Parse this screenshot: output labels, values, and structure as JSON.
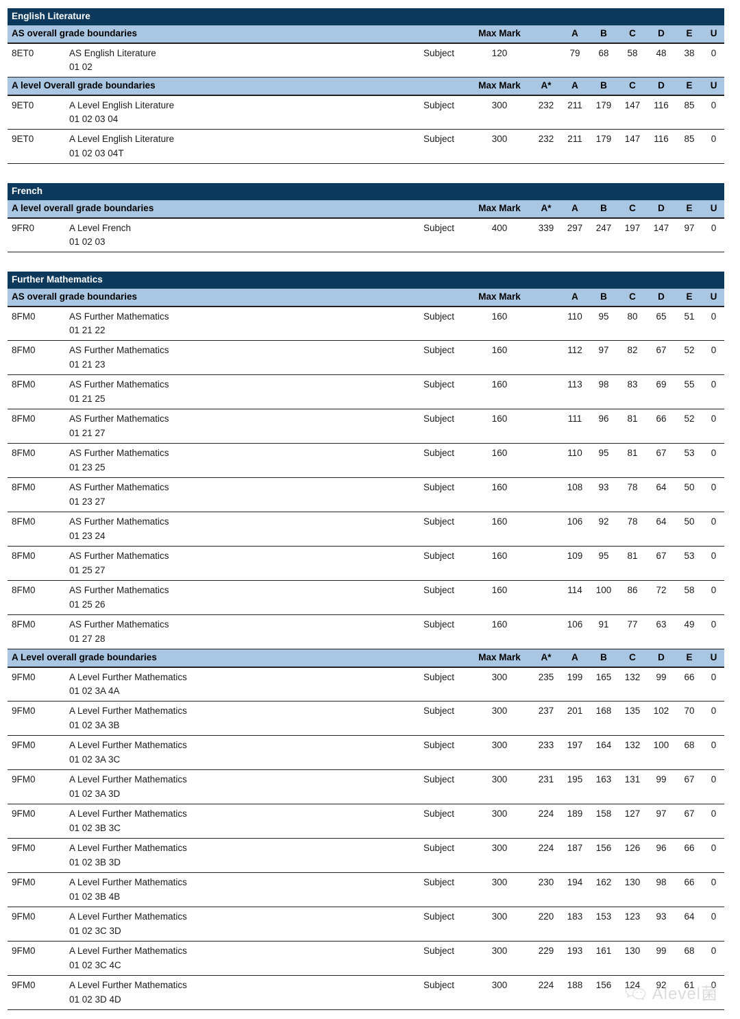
{
  "colors": {
    "subject_band": "#0d3a5c",
    "header_band": "#a9c7e2",
    "rule": "#231f20",
    "text": "#1a1a1a",
    "watermark": "#b9b9bd"
  },
  "columns": {
    "max_mark": "Max Mark",
    "a_star": "A*",
    "a": "A",
    "b": "B",
    "c": "C",
    "d": "D",
    "e": "E",
    "u": "U",
    "subject_type": "Subject"
  },
  "blocks": [
    {
      "subject": "English Literature",
      "sections": [
        {
          "heading": "AS overall grade boundaries",
          "has_astar": false,
          "rows": [
            {
              "code": "8ET0",
              "title": "AS English Literature",
              "options": "01 02",
              "type": "Subject",
              "max_mark": "120",
              "a_star": "",
              "a": "79",
              "b": "68",
              "c": "58",
              "d": "48",
              "e": "38",
              "u": "0"
            }
          ]
        },
        {
          "heading": "A level Overall grade boundaries",
          "has_astar": true,
          "rows": [
            {
              "code": "9ET0",
              "title": "A Level English Literature",
              "options": "01 02 03 04",
              "type": "Subject",
              "max_mark": "300",
              "a_star": "232",
              "a": "211",
              "b": "179",
              "c": "147",
              "d": "116",
              "e": "85",
              "u": "0"
            },
            {
              "code": "9ET0",
              "title": "A Level English Literature",
              "options": "01 02 03 04T",
              "type": "Subject",
              "max_mark": "300",
              "a_star": "232",
              "a": "211",
              "b": "179",
              "c": "147",
              "d": "116",
              "e": "85",
              "u": "0"
            }
          ]
        }
      ]
    },
    {
      "subject": "French",
      "sections": [
        {
          "heading": "A level overall grade boundaries",
          "has_astar": true,
          "rows": [
            {
              "code": "9FR0",
              "title": "A Level French",
              "options": "01 02 03",
              "type": "Subject",
              "max_mark": "400",
              "a_star": "339",
              "a": "297",
              "b": "247",
              "c": "197",
              "d": "147",
              "e": "97",
              "u": "0"
            }
          ]
        }
      ]
    },
    {
      "subject": "Further Mathematics",
      "sections": [
        {
          "heading": "AS overall grade boundaries",
          "has_astar": false,
          "rows": [
            {
              "code": "8FM0",
              "title": "AS Further Mathematics",
              "options": "01 21 22",
              "type": "Subject",
              "max_mark": "160",
              "a_star": "",
              "a": "110",
              "b": "95",
              "c": "80",
              "d": "65",
              "e": "51",
              "u": "0"
            },
            {
              "code": "8FM0",
              "title": "AS Further Mathematics",
              "options": "01 21 23",
              "type": "Subject",
              "max_mark": "160",
              "a_star": "",
              "a": "112",
              "b": "97",
              "c": "82",
              "d": "67",
              "e": "52",
              "u": "0"
            },
            {
              "code": "8FM0",
              "title": "AS Further Mathematics",
              "options": "01 21 25",
              "type": "Subject",
              "max_mark": "160",
              "a_star": "",
              "a": "113",
              "b": "98",
              "c": "83",
              "d": "69",
              "e": "55",
              "u": "0"
            },
            {
              "code": "8FM0",
              "title": "AS Further Mathematics",
              "options": "01 21 27",
              "type": "Subject",
              "max_mark": "160",
              "a_star": "",
              "a": "111",
              "b": "96",
              "c": "81",
              "d": "66",
              "e": "52",
              "u": "0"
            },
            {
              "code": "8FM0",
              "title": "AS Further Mathematics",
              "options": "01 23 25",
              "type": "Subject",
              "max_mark": "160",
              "a_star": "",
              "a": "110",
              "b": "95",
              "c": "81",
              "d": "67",
              "e": "53",
              "u": "0"
            },
            {
              "code": "8FM0",
              "title": "AS Further Mathematics",
              "options": "01 23 27",
              "type": "Subject",
              "max_mark": "160",
              "a_star": "",
              "a": "108",
              "b": "93",
              "c": "78",
              "d": "64",
              "e": "50",
              "u": "0"
            },
            {
              "code": "8FM0",
              "title": "AS Further Mathematics",
              "options": "01 23 24",
              "type": "Subject",
              "max_mark": "160",
              "a_star": "",
              "a": "106",
              "b": "92",
              "c": "78",
              "d": "64",
              "e": "50",
              "u": "0"
            },
            {
              "code": "8FM0",
              "title": "AS Further Mathematics",
              "options": "01 25 27",
              "type": "Subject",
              "max_mark": "160",
              "a_star": "",
              "a": "109",
              "b": "95",
              "c": "81",
              "d": "67",
              "e": "53",
              "u": "0"
            },
            {
              "code": "8FM0",
              "title": "AS Further Mathematics",
              "options": "01 25 26",
              "type": "Subject",
              "max_mark": "160",
              "a_star": "",
              "a": "114",
              "b": "100",
              "c": "86",
              "d": "72",
              "e": "58",
              "u": "0"
            },
            {
              "code": "8FM0",
              "title": "AS Further Mathematics",
              "options": "01 27 28",
              "type": "Subject",
              "max_mark": "160",
              "a_star": "",
              "a": "106",
              "b": "91",
              "c": "77",
              "d": "63",
              "e": "49",
              "u": "0"
            }
          ]
        },
        {
          "heading": "A Level overall grade boundaries",
          "has_astar": true,
          "rows": [
            {
              "code": "9FM0",
              "title": "A Level Further Mathematics",
              "options": "01 02 3A 4A",
              "type": "Subject",
              "max_mark": "300",
              "a_star": "235",
              "a": "199",
              "b": "165",
              "c": "132",
              "d": "99",
              "e": "66",
              "u": "0"
            },
            {
              "code": "9FM0",
              "title": "A Level Further Mathematics",
              "options": "01 02 3A 3B",
              "type": "Subject",
              "max_mark": "300",
              "a_star": "237",
              "a": "201",
              "b": "168",
              "c": "135",
              "d": "102",
              "e": "70",
              "u": "0"
            },
            {
              "code": "9FM0",
              "title": "A Level Further Mathematics",
              "options": "01 02 3A 3C",
              "type": "Subject",
              "max_mark": "300",
              "a_star": "233",
              "a": "197",
              "b": "164",
              "c": "132",
              "d": "100",
              "e": "68",
              "u": "0"
            },
            {
              "code": "9FM0",
              "title": "A Level Further Mathematics",
              "options": "01 02 3A 3D",
              "type": "Subject",
              "max_mark": "300",
              "a_star": "231",
              "a": "195",
              "b": "163",
              "c": "131",
              "d": "99",
              "e": "67",
              "u": "0"
            },
            {
              "code": "9FM0",
              "title": "A Level Further Mathematics",
              "options": "01 02 3B 3C",
              "type": "Subject",
              "max_mark": "300",
              "a_star": "224",
              "a": "189",
              "b": "158",
              "c": "127",
              "d": "97",
              "e": "67",
              "u": "0"
            },
            {
              "code": "9FM0",
              "title": "A Level Further Mathematics",
              "options": "01 02 3B 3D",
              "type": "Subject",
              "max_mark": "300",
              "a_star": "224",
              "a": "187",
              "b": "156",
              "c": "126",
              "d": "96",
              "e": "66",
              "u": "0"
            },
            {
              "code": "9FM0",
              "title": "A Level Further Mathematics",
              "options": "01 02 3B 4B",
              "type": "Subject",
              "max_mark": "300",
              "a_star": "230",
              "a": "194",
              "b": "162",
              "c": "130",
              "d": "98",
              "e": "66",
              "u": "0"
            },
            {
              "code": "9FM0",
              "title": "A Level Further Mathematics",
              "options": "01 02 3C 3D",
              "type": "Subject",
              "max_mark": "300",
              "a_star": "220",
              "a": "183",
              "b": "153",
              "c": "123",
              "d": "93",
              "e": "64",
              "u": "0"
            },
            {
              "code": "9FM0",
              "title": "A Level Further Mathematics",
              "options": "01 02 3C 4C",
              "type": "Subject",
              "max_mark": "300",
              "a_star": "229",
              "a": "193",
              "b": "161",
              "c": "130",
              "d": "99",
              "e": "68",
              "u": "0"
            },
            {
              "code": "9FM0",
              "title": "A Level Further Mathematics",
              "options": "01 02 3D 4D",
              "type": "Subject",
              "max_mark": "300",
              "a_star": "224",
              "a": "188",
              "b": "156",
              "c": "124",
              "d": "92",
              "e": "61",
              "u": "0"
            }
          ]
        }
      ]
    }
  ],
  "watermark": {
    "text": "Alevel菌",
    "icon": "wechat-icon"
  }
}
